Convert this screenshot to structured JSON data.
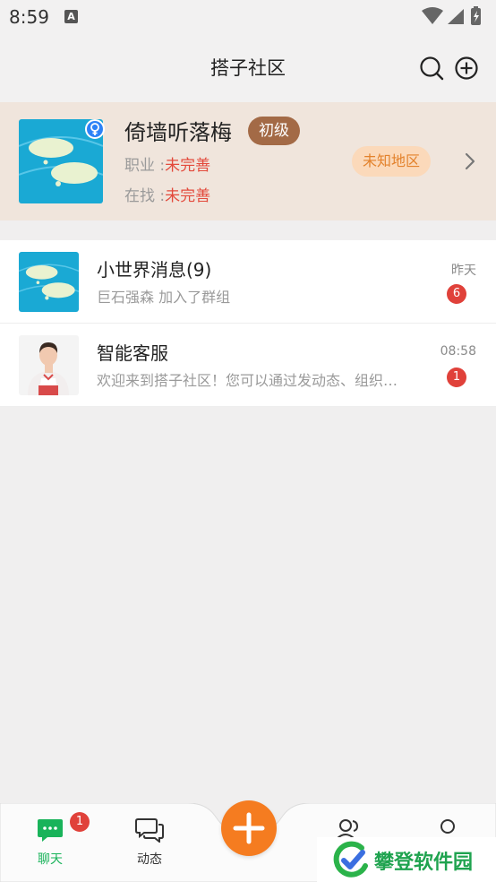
{
  "status_bar": {
    "time": "8:59",
    "notif_icon": "A"
  },
  "header": {
    "title": "搭子社区"
  },
  "profile": {
    "name": "倚墙听落梅",
    "level": "初级",
    "job_label": "职业 :",
    "job_value": "未完善",
    "seeking_label": "在找 :",
    "seeking_value": "未完善",
    "region": "未知地区"
  },
  "chats": [
    {
      "name": "小世界消息(9)",
      "message": "巨石强森 加入了群组",
      "time": "昨天",
      "unread": "6"
    },
    {
      "name": "智能客服",
      "message": "欢迎来到搭子社区！您可以通过发动态、组织活动、加入群组来寻找你的搭子",
      "time": "08:58",
      "unread": "1"
    }
  ],
  "tabbar": {
    "chat_label": "聊天",
    "chat_badge": "1",
    "moments_label": "动态"
  },
  "watermark": {
    "text": "攀登软件园"
  },
  "colors": {
    "accent": "#19b35a",
    "fab": "#f57c20",
    "badge": "#e0413a",
    "level": "#a36a46",
    "warning": "#e34a3c"
  }
}
